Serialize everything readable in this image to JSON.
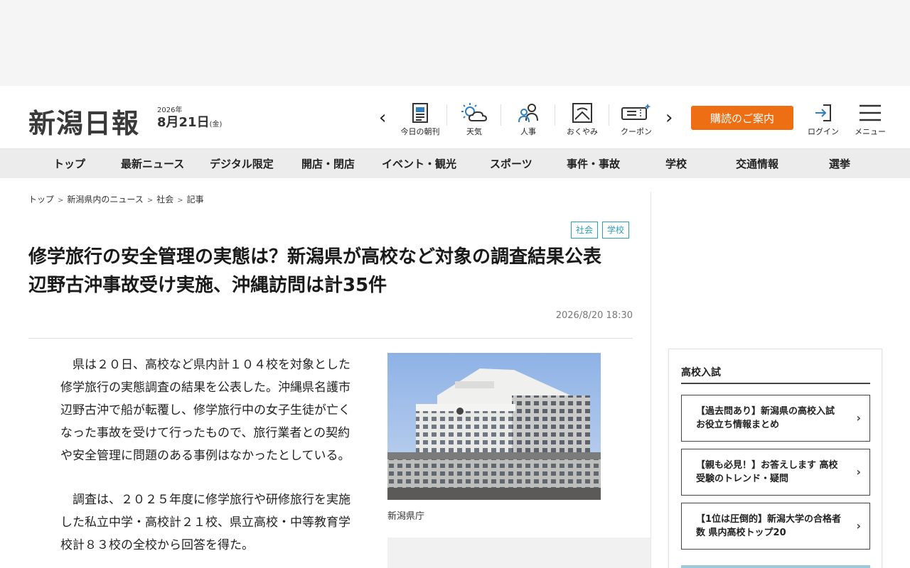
{
  "header": {
    "logo": "新潟日報",
    "year": "2026年",
    "month_day": "8月21日",
    "weekday": "(金)",
    "quick_links": [
      {
        "label": "今日の朝刊",
        "icon": "newspaper-icon"
      },
      {
        "label": "天気",
        "icon": "weather-icon"
      },
      {
        "label": "人事",
        "icon": "people-icon"
      },
      {
        "label": "おくやみ",
        "icon": "condolence-icon"
      },
      {
        "label": "クーポン",
        "icon": "coupon-icon"
      }
    ],
    "subscribe_label": "購読のご案内",
    "login_label": "ログイン",
    "menu_label": "メニュー"
  },
  "global_nav": [
    "トップ",
    "最新ニュース",
    "デジタル限定",
    "開店・閉店",
    "イベント・観光",
    "スポーツ",
    "事件・事故",
    "学校",
    "交通情報",
    "選挙"
  ],
  "breadcrumb": [
    "トップ",
    "新潟県内のニュース",
    "社会",
    "記事"
  ],
  "article": {
    "tags": [
      "社会",
      "学校"
    ],
    "title": "修学旅行の安全管理の実態は？新潟県が高校など対象の調査結果公表　辺野古沖事故受け実施、沖縄訪問は計35件",
    "date": "2026/8/20 18:30",
    "paragraphs": [
      "県は２０日、高校など県内計１０４校を対象とした修学旅行の実態調査の結果を公表した。沖縄県名護市辺野古沖で船が転覆し、修学旅行中の女子生徒が亡くなった事故を受けて行ったもので、旅行業者との契約や安全管理に問題のある事例はなかったとしている。",
      "調査は、２０２５年度に修学旅行や研修旅行を実施した私立中学・高校計２１校、県立高校・中等教育学校計８３校の全校から回答を得た。"
    ],
    "photo_caption": "新潟県庁"
  },
  "sidebar": {
    "title": "高校入試",
    "links": [
      "【過去問あり】新潟県の高校入試 お役立ち情報まとめ",
      "【親も必見！】お答えします 高校受験のトレンド・疑問",
      "【1位は圧倒的】新潟大学の合格者数 県内高校トップ20"
    ]
  },
  "colors": {
    "accent": "#ee6e14",
    "tag": "#2aa0b4",
    "nav_bg": "#ececec"
  }
}
